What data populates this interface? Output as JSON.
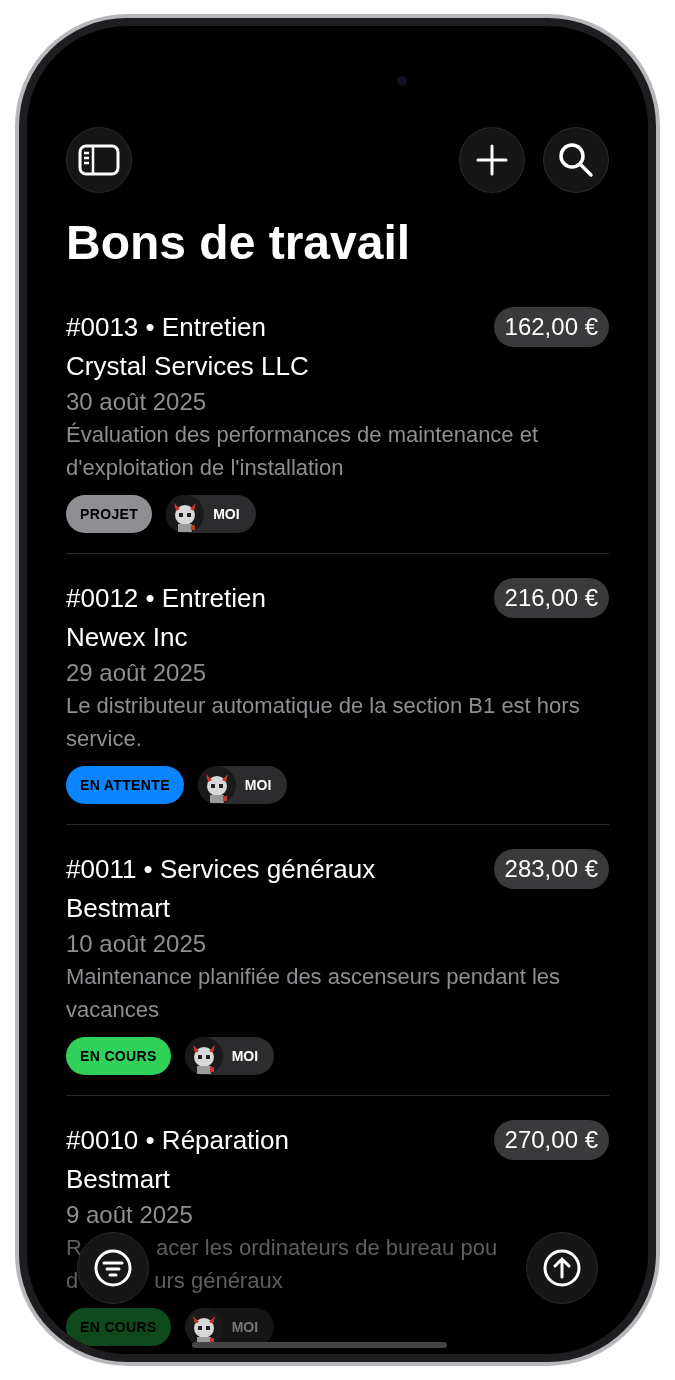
{
  "title": "Bons de travail",
  "orders": [
    {
      "heading": "#0013 • Entretien",
      "amount": "162,00 €",
      "client": "Crystal Services LLC",
      "date": "30 août 2025",
      "description": "Évaluation des performances de maintenance et d'exploitation de l'installation",
      "status": {
        "label": "PROJET",
        "color": "#8e8e93"
      },
      "assignee": "MOI",
      "dimmed": false
    },
    {
      "heading": "#0012 • Entretien",
      "amount": "216,00 €",
      "client": "Newex Inc",
      "date": "29 août 2025",
      "description": "Le distributeur automatique de la section B1 est hors service.",
      "status": {
        "label": "EN ATTENTE",
        "color": "#0a84ff"
      },
      "assignee": "MOI",
      "dimmed": false
    },
    {
      "heading": "#0011 • Services généraux",
      "amount": "283,00 €",
      "client": "Bestmart",
      "date": "10 août 2025",
      "description": "Maintenance planifiée des ascenseurs pendant les vacances",
      "status": {
        "label": "EN COURS",
        "color": "#30d158"
      },
      "assignee": "MOI",
      "dimmed": false
    },
    {
      "heading": "#0010 • Réparation",
      "amount": "270,00 €",
      "client": "Bestmart",
      "date": "9 août 2025",
      "description_lines": [
        {
          "parts": [
            "R",
            "acer les ordinateurs de bureau pou"
          ]
        },
        {
          "parts": [
            "d",
            "urs généraux"
          ]
        }
      ],
      "status": {
        "label": "EN COURS",
        "color": "#0e4a1c"
      },
      "assignee": "MOI",
      "dimmed": true
    }
  ]
}
